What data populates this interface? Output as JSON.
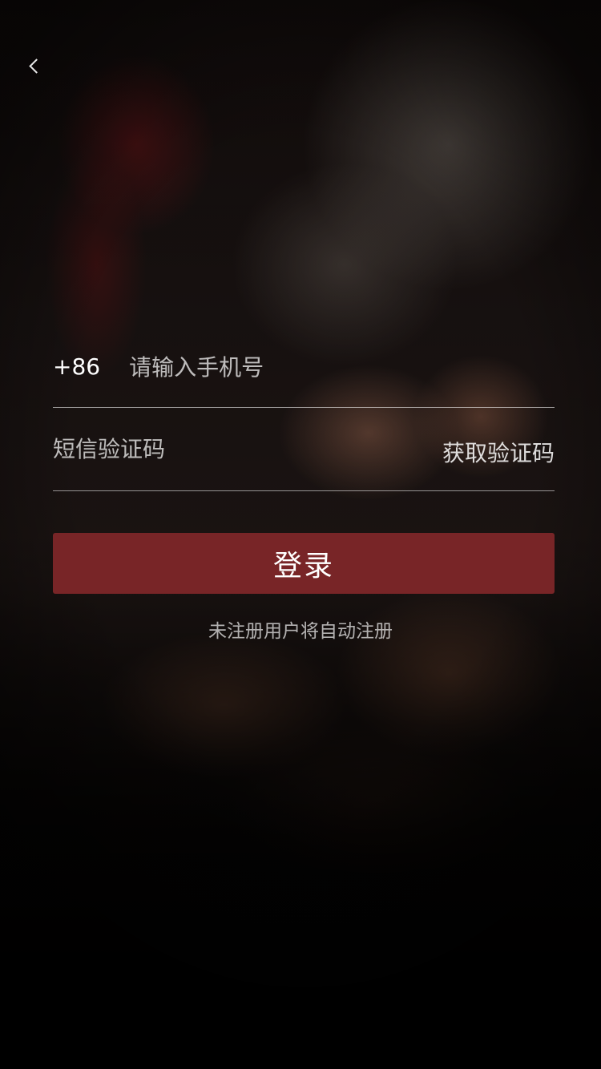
{
  "nav": {
    "back_icon": "chevron-left-icon"
  },
  "form": {
    "country_code": "+86",
    "phone_placeholder": "请输入手机号",
    "phone_value": "",
    "sms_placeholder": "短信验证码",
    "sms_value": "",
    "get_code_label": "获取验证码"
  },
  "actions": {
    "login_label": "登录",
    "auto_register_note": "未注册用户将自动注册"
  },
  "colors": {
    "login_button": "#782527",
    "text": "#ffffff"
  }
}
